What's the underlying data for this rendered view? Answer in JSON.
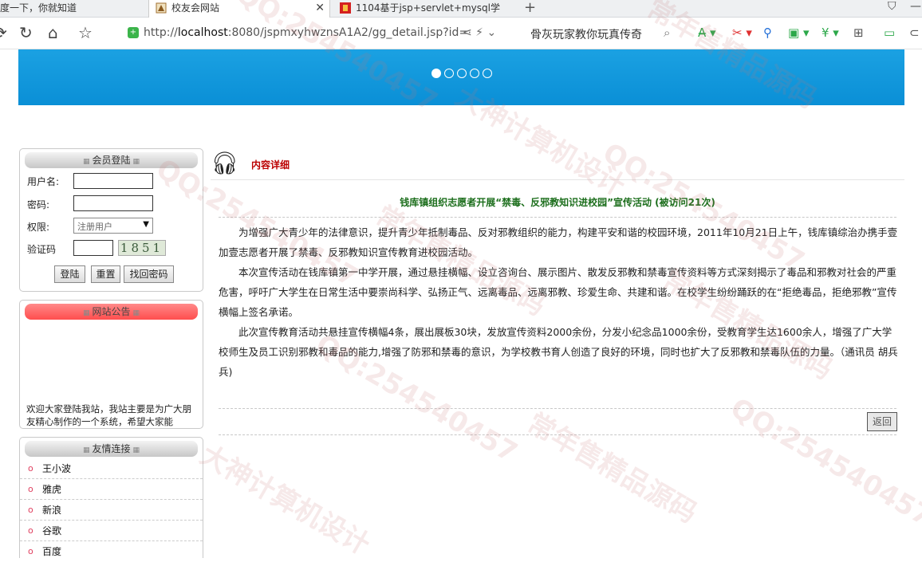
{
  "browser": {
    "tabs": [
      {
        "title": "度一下，你就知道",
        "active": false
      },
      {
        "title": "校友会网站",
        "active": true
      },
      {
        "title": "1104基于jsp+servlet+mysql学",
        "active": false
      }
    ],
    "new_tab": "+",
    "close_glyph": "✕",
    "url_prefix": "http://",
    "url_host": "localhost",
    "url_rest": ":8080/jspmxyhwznsA1A2/gg_detail.jsp?id=",
    "search_text": "骨灰玩家教你玩真传奇"
  },
  "banner": {
    "dots": 5,
    "active_dot": 0
  },
  "login": {
    "title": "会员登陆",
    "username_label": "用户名:",
    "password_label": "密码:",
    "role_label": "权限:",
    "role_value": "注册用户",
    "captcha_label": "验证码",
    "captcha_text": "1851",
    "login_button": "登陆",
    "reset_button": "重置",
    "forgot_button": "找回密码"
  },
  "notice": {
    "title": "网站公告",
    "text": "欢迎大家登陆我站，我站主要是为广大朋友精心制作的一个系统，希望大家能"
  },
  "links": {
    "title": "友情连接",
    "items": [
      "王小波",
      "雅虎",
      "新浪",
      "谷歌",
      "百度"
    ]
  },
  "content": {
    "section_label": "内容详细",
    "title": "钱库镇组织志愿者开展“禁毒、反邪教知识进校园”宣传活动 (被访问21次)",
    "paragraphs": [
      "为增强广大青少年的法律意识，提升青少年抵制毒品、反对邪教组织的能力，构建平安和谐的校园环境，2011年10月21日上午，钱库镇综治办携手壹加壹志愿者开展了禁毒、反邪教知识宣传教育进校园活动。",
      "本次宣传活动在钱库镇第一中学开展，通过悬挂横幅、设立咨询台、展示图片、散发反邪教和禁毒宣传资料等方式深刻揭示了毒品和邪教对社会的严重危害，呼吁广大学生在日常生活中要崇尚科学、弘扬正气、远离毒品、远离邪教、珍爱生命、共建和谐。在校学生纷纷踊跃的在“拒绝毒品，拒绝邪教”宣传横幅上签名承诺。",
      "此次宣传教育活动共悬挂宣传横幅4条，展出展板30块，发放宣传资料2000余份，分发小纪念品1000余份，受教育学生达1600余人，增强了广大学校师生及员工识别邪教和毒品的能力,增强了防邪和禁毒的意识，为学校教书育人创造了良好的环境，同时也扩大了反邪教和禁毒队伍的力量。（通讯员 胡兵兵)"
    ],
    "back_button": "返回"
  },
  "watermark": {
    "qq": "QQ:254540457",
    "line1": "大神计算机设计",
    "line2": "常年售精品源码"
  }
}
